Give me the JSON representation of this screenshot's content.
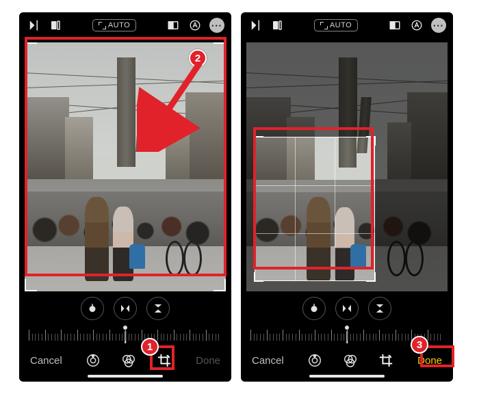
{
  "toolbar": {
    "auto_label": "AUTO"
  },
  "bottom": {
    "cancel": "Cancel",
    "done_inactive": "Done",
    "done_active": "Done"
  },
  "annotations": {
    "step1": "1",
    "step2": "2",
    "step3": "3"
  },
  "icons": {
    "flip_vertical": "flip-vertical-icon",
    "flip_horizontal": "flip-horizontal-icon",
    "auto": "auto-icon",
    "aspect": "aspect-ratio-icon",
    "markup": "markup-icon",
    "more": "more-icon",
    "rotate": "rotate-icon",
    "mirror_h": "mirror-horizontal-icon",
    "mirror_v": "mirror-vertical-icon",
    "adjust": "adjust-icon",
    "filters": "filters-icon",
    "crop": "crop-icon"
  }
}
